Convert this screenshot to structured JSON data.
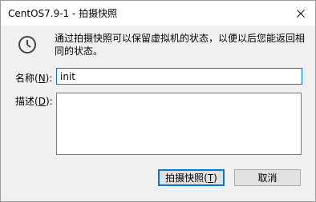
{
  "window": {
    "title": "CentOS7.9-1 - 拍摄快照"
  },
  "message": "通过拍摄快照可以保留虚拟机的状态，以便以后您能返回相同的状态。",
  "name_field": {
    "label_prefix": "名称(",
    "label_accel": "N",
    "label_suffix": "):",
    "value": "init"
  },
  "description_field": {
    "label_prefix": "描述(",
    "label_accel": "D",
    "label_suffix": "):",
    "value": ""
  },
  "buttons": {
    "ok_prefix": "拍摄快照(",
    "ok_accel": "T",
    "ok_suffix": ")",
    "cancel_label": "取消"
  },
  "icons": {
    "close": "close-icon",
    "info": "clock-icon"
  },
  "colors": {
    "accent": "#0078d7",
    "dialog_bg": "#f0f0f0",
    "button_bg": "#e1e1e1"
  }
}
